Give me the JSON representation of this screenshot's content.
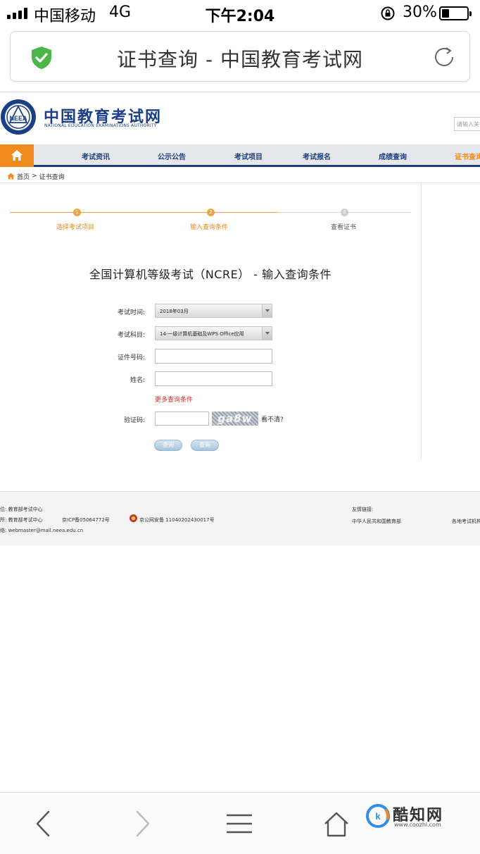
{
  "status_bar": {
    "carrier": "中国移动",
    "network": "4G",
    "time": "下午2:04",
    "battery": "30%",
    "battery_level": 0.3
  },
  "browser": {
    "page_title": "证书查询 - 中国教育考试网"
  },
  "site": {
    "logo_cn": "中国教育考试网",
    "logo_en": "NATIONAL EDUCATION EXAMINATIONS AUTHORITY",
    "emblem_text": "NEEA",
    "search_placeholder": "请输入关键字"
  },
  "nav": {
    "items": [
      "考试资讯",
      "公示公告",
      "考试项目",
      "考试报名",
      "成绩查询",
      "证书查询"
    ]
  },
  "breadcrumb": {
    "home": "首页",
    "separator": ">",
    "current": "证书查询"
  },
  "steps": [
    {
      "num": "1",
      "label": "选择考试项目",
      "status": "done"
    },
    {
      "num": "2",
      "label": "输入查询条件",
      "status": "done"
    },
    {
      "num": "3",
      "label": "查看证书",
      "status": "todo"
    }
  ],
  "form": {
    "title": "全国计算机等级考试（NCRE） - 输入查询条件",
    "exam_time_label": "考试时间:",
    "exam_time_value": "2018年03月",
    "subject_label": "考试科目:",
    "subject_value": "14-一级计算机基础及WPS Office应用",
    "cert_no_label": "证件号码:",
    "name_label": "姓名:",
    "more_conditions": "更多查询条件",
    "captcha_label": "验证码:",
    "captcha_text": "ga8w",
    "captcha_refresh": "看不清?",
    "btn_query_1": "查询",
    "btn_query_2": "查询"
  },
  "footer": {
    "line1": "位: 教育部考试中心",
    "line2": "所: 教育部考试中心",
    "icp": "京ICP备05064772号",
    "police": "京公网安备 11040202430017号",
    "line3": "络: webmaster@mail.neea.edu.cn",
    "links_label": "友情链接:",
    "link1": "中华人民共和国教育部",
    "link2": "各地考试机构"
  },
  "watermark": {
    "text": "酷知网",
    "url": "www.coozhi.com"
  },
  "colors": {
    "nav_blue": "#1e3f7d",
    "accent_orange": "#f08a1c",
    "link_red": "#d9302c",
    "shield_green": "#4cb648"
  },
  "icons": {
    "home": "home-icon",
    "shield": "shield-icon",
    "reload": "reload-icon",
    "back": "back-arrow-icon",
    "forward": "forward-arrow-icon",
    "menu": "menu-icon",
    "home_toolbar": "house-icon"
  }
}
